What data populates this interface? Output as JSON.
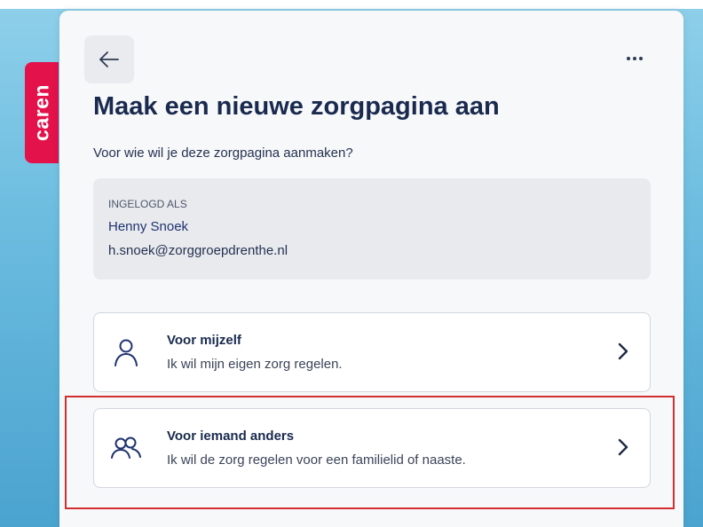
{
  "brand": {
    "name": "caren"
  },
  "header": {
    "title": "Maak een nieuwe zorgpagina aan",
    "subtitle": "Voor wie wil je deze zorgpagina aanmaken?"
  },
  "login": {
    "label": "INGELOGD ALS",
    "name": "Henny Snoek",
    "email": "h.snoek@zorggroepdrenthe.nl"
  },
  "options": [
    {
      "title": "Voor mijzelf",
      "description": "Ik wil mijn eigen zorg regelen.",
      "icon": "person-icon"
    },
    {
      "title": "Voor iemand anders",
      "description": "Ik wil de zorg regelen voor een familielid of naaste.",
      "icon": "people-icon"
    }
  ],
  "colors": {
    "brand": "#e3124b",
    "title": "#192a4e",
    "highlight": "#d32f2f"
  }
}
